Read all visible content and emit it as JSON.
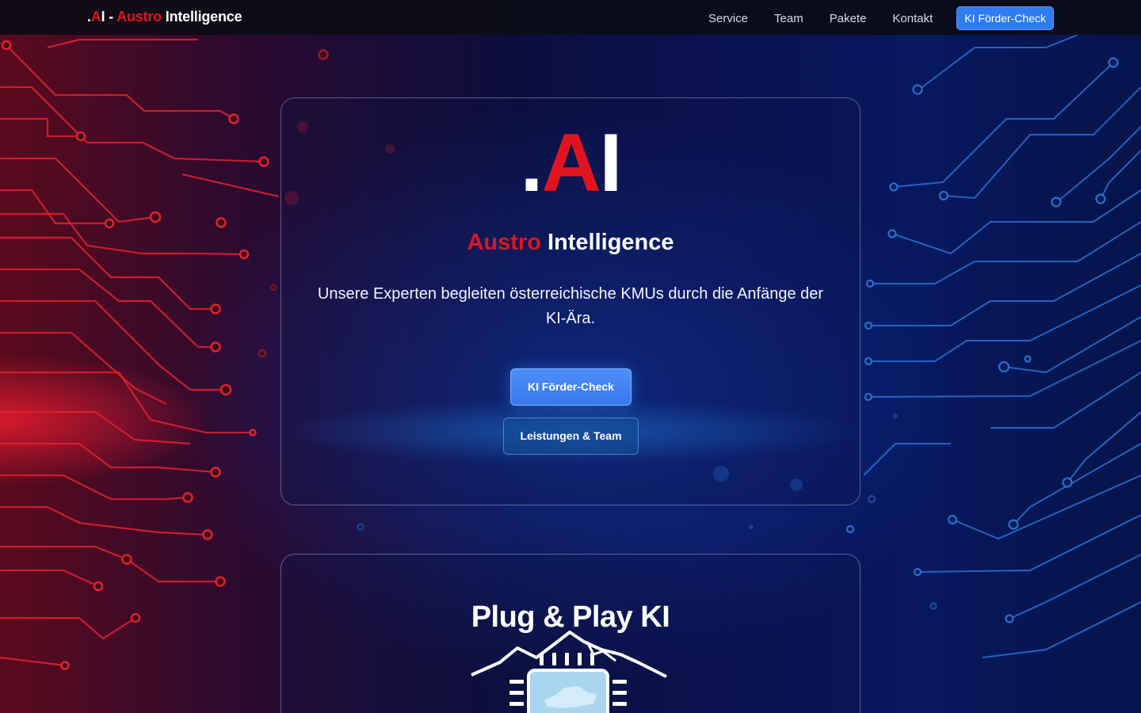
{
  "nav": {
    "brand_prefix": ".",
    "brand_a": "A",
    "brand_i": "I - ",
    "brand_austro": "Austro",
    "brand_intelligence": " Intelligence",
    "links": [
      "Service",
      "Team",
      "Pakete",
      "Kontakt"
    ],
    "cta_label": "KI Förder-Check"
  },
  "hero": {
    "logo_dot": ".",
    "logo_a": "A",
    "logo_i": "I",
    "title_austro": "Austro",
    "title_intelligence": " Intelligence",
    "text": "Unsere Experten begleiten österreichische KMUs durch die Anfänge der KI-Ära.",
    "primary_button": "KI Förder-Check",
    "secondary_button": "Leistungen & Team"
  },
  "section2": {
    "title": "Plug & Play KI"
  },
  "colors": {
    "accent_red": "#e0141e",
    "accent_blue": "#2f7bf0",
    "circuit_red": "#e3202e",
    "circuit_blue": "#2a7fe8"
  },
  "icons": {
    "plug_logo": "mountain-chip-icon"
  }
}
